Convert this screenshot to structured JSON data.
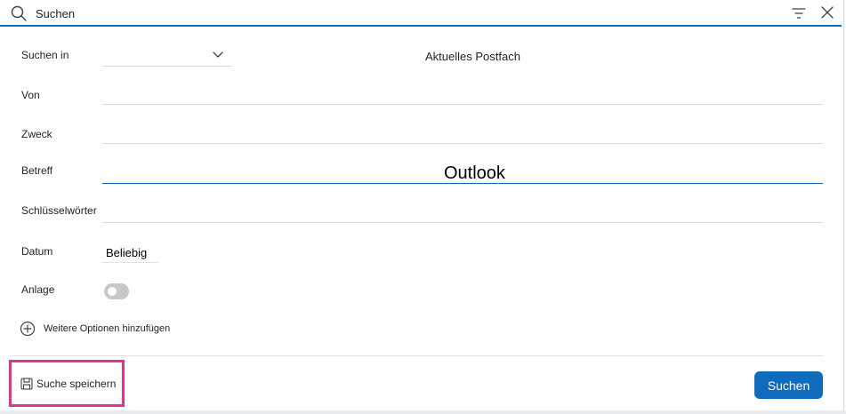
{
  "search": {
    "value": "Suchen",
    "placeholder": "Suchen"
  },
  "form": {
    "search_in": {
      "label": "Suchen in",
      "value": "",
      "display": "Aktuelles Postfach"
    },
    "from": {
      "label": "Von"
    },
    "to": {
      "label": "Zweck"
    },
    "subject": {
      "label": "Betreff",
      "overlay_text": "Outlook"
    },
    "keywords": {
      "label": "Schlüsselwörter"
    },
    "date": {
      "label": "Datum",
      "value": "Beliebig"
    },
    "attachment": {
      "label": "Anlage",
      "on": false
    },
    "add_options_label": "Weitere Optionen hinzufügen"
  },
  "footer": {
    "save_search_label": "Suche speichern",
    "search_button_label": "Suchen",
    "highlight_color": "#e0358a",
    "accent_color": "#0f6cbd"
  },
  "icons": {
    "search": "search-icon",
    "filter": "filter-icon",
    "close": "close-icon",
    "chevron": "chevron-down-icon",
    "plus": "plus-circle-icon",
    "save": "save-icon"
  }
}
